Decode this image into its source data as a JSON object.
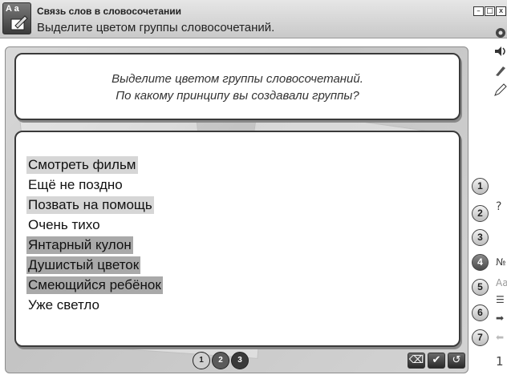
{
  "header": {
    "title": "Связь слов в словосочетании",
    "subtitle": "Выделите цветом группы словосочетаний.",
    "logo_text": "A a"
  },
  "window_buttons": [
    "–",
    "□",
    "x"
  ],
  "question": {
    "line1": "Выделите цветом группы словосочетаний.",
    "line2": "По какому принципу вы создавали группы?"
  },
  "phrases": [
    {
      "text": "Смотреть фильм",
      "highlight": "light"
    },
    {
      "text": "Ещё не поздно",
      "highlight": "none"
    },
    {
      "text": "Позвать на помощь",
      "highlight": "light"
    },
    {
      "text": "Очень тихо",
      "highlight": "none"
    },
    {
      "text": "Янтарный кулон",
      "highlight": "dark"
    },
    {
      "text": "Душистый цветок",
      "highlight": "dark"
    },
    {
      "text": "Смеющийся ребёнок",
      "highlight": "dark"
    },
    {
      "text": "Уже светло",
      "highlight": "none"
    }
  ],
  "pager": [
    "1",
    "2",
    "3"
  ],
  "controls": {
    "reset_icon": "pencil-eraser-icon",
    "check_icon": "check-icon",
    "undo_icon": "undo-icon",
    "check_glyph": "✔",
    "undo_glyph": "↺",
    "reset_glyph": "⌫"
  },
  "side_numbers": [
    "1",
    "2",
    "3",
    "4",
    "5",
    "6",
    "7"
  ],
  "side_icons": {
    "help": "?",
    "numbering": "№",
    "font": "Aa",
    "list": "☰",
    "arrow_right": "➡",
    "arrow_left": "⬅",
    "page_number": "1"
  },
  "top_side_icons": [
    "camera-icon",
    "speaker-icon",
    "brush-icon",
    "pencil-icon"
  ]
}
